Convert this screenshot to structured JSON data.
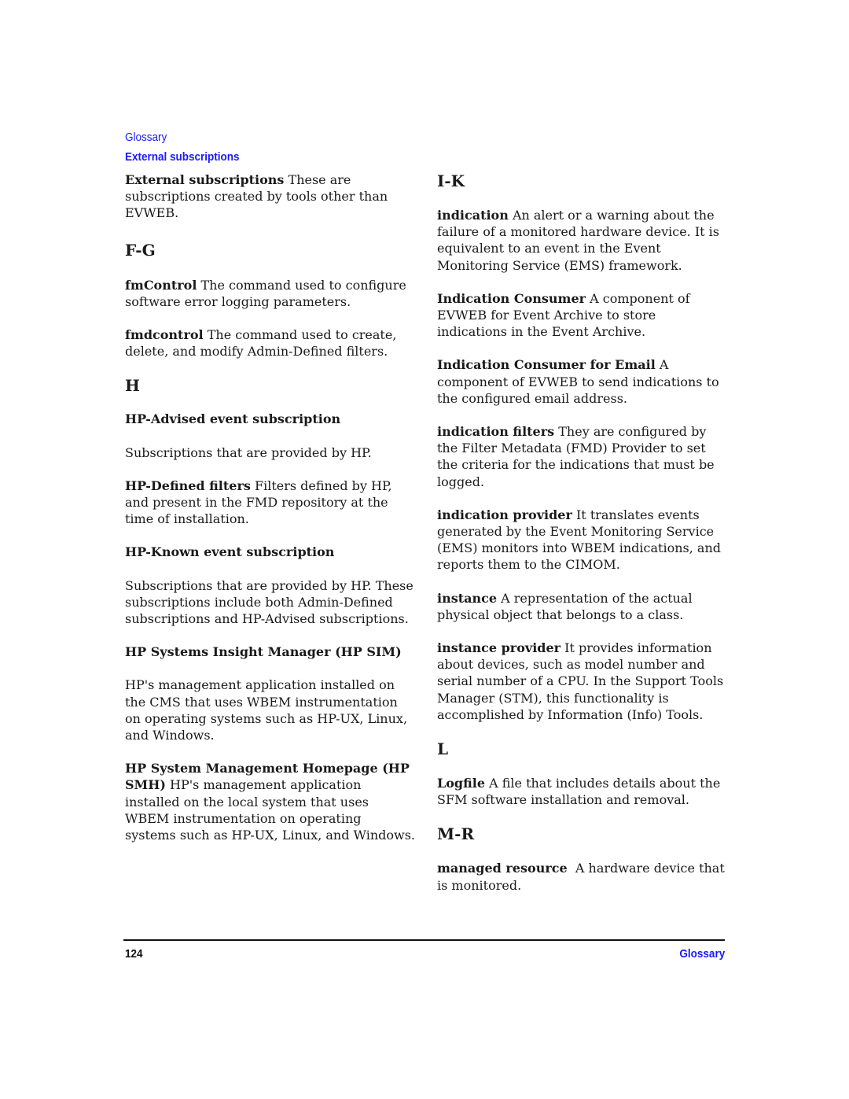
{
  "header": {
    "section": "Glossary",
    "subsection": "External subscriptions"
  },
  "left": {
    "e1": {
      "term": "External subscriptions",
      "def": " These are subscriptions created by tools other than EVWEB."
    },
    "h_fg": "F-G",
    "fg1": {
      "term": "fmControl",
      "def": " The command used to configure software error logging parameters."
    },
    "fg2": {
      "term": "fmdcontrol",
      "def": " The command used to create, delete, and modify Admin-Defined filters."
    },
    "h_h": "H",
    "h1": {
      "term": "HP-Advised event subscription",
      "def": "Subscriptions that are provided by HP."
    },
    "h2": {
      "term": "HP-Defined filters",
      "def": " Filters defined by HP, and present in the FMD repository at the time of installation."
    },
    "h3": {
      "term": "HP-Known event subscription",
      "def": "Subscriptions that are provided by HP. These subscriptions include both Admin-Defined subscriptions and HP-Advised subscriptions."
    },
    "h4": {
      "term": "HP Systems Insight Manager (HP SIM)",
      "def": "HP's management application installed on the CMS that uses WBEM instrumentation on operating systems such as HP-UX, Linux, and Windows."
    },
    "h5": {
      "term": "HP System Management Homepage (HP SMH)",
      "def": " HP's management application installed on the local system that uses WBEM instrumentation on operating systems such as HP-UX, Linux, and Windows."
    }
  },
  "right": {
    "h_ik": "I-K",
    "i1": {
      "term": "indication",
      "def": " An alert or a warning about the failure of a monitored hardware device. It is equivalent to an event in the Event Monitoring Service (EMS) framework."
    },
    "i2": {
      "term": "Indication Consumer",
      "def": " A component of EVWEB for Event Archive to store indications in the Event Archive."
    },
    "i3": {
      "term": "Indication Consumer for Email",
      "def": " A component of EVWEB to send indications to the configured email address."
    },
    "i4": {
      "term": "indication filters",
      "def": " They are configured by the Filter Metadata (FMD) Provider to set the criteria for the indications that must be logged."
    },
    "i5": {
      "term": "indication provider",
      "def": " It translates events generated by the Event Monitoring Service (EMS) monitors into WBEM indications, and reports them to the CIMOM."
    },
    "i6": {
      "term": "instance",
      "def": " A representation of the actual physical object that belongs to a class."
    },
    "i7": {
      "term": "instance provider",
      "def": " It provides information about devices, such as model number and serial number of a CPU. In the Support Tools Manager (STM), this functionality is accomplished by Information (Info) Tools."
    },
    "h_l": "L",
    "l1": {
      "term": "Logfile",
      "def": " A file that includes details about the SFM software installation and removal."
    },
    "h_mr": "M-R",
    "m1": {
      "term": "managed resource",
      "def": "  A hardware device that is monitored."
    }
  },
  "footer": {
    "page_number": "124",
    "title": "Glossary"
  }
}
